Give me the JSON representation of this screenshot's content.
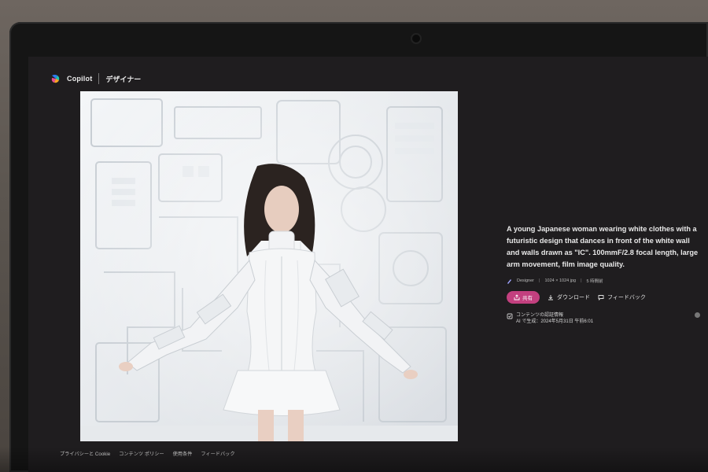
{
  "header": {
    "brand": "Copilot",
    "section_title": "デザイナー",
    "logo_icon": "copilot-logo"
  },
  "image": {
    "alt_subject": "generated-image-woman-white-futuristic-outfit"
  },
  "panel": {
    "prompt": "A young Japanese woman wearing white clothes with a futuristic design that dances in front of the white wall and walls drawn as \"IC\". 100mmF/2.8 focal length, large arm movement, film image quality.",
    "meta": {
      "source": "Designer",
      "dimensions": "1024 × 1024 jpg",
      "age": "5 時間前"
    },
    "actions": {
      "share": "共有",
      "download": "ダウンロード",
      "feedback": "フィードバック"
    },
    "credentials": {
      "title": "コンテンツの認証情報",
      "generated": "AI で生成：2024年5月31日 午前6:01"
    }
  },
  "footer": {
    "links": [
      "プライバシーと Cookie",
      "コンテンツ ポリシー",
      "使用条件",
      "フィードバック"
    ]
  },
  "colors": {
    "screen_bg": "#1f1d1f",
    "share_button": "#c3407f",
    "text_primary": "#e8e8e8"
  }
}
